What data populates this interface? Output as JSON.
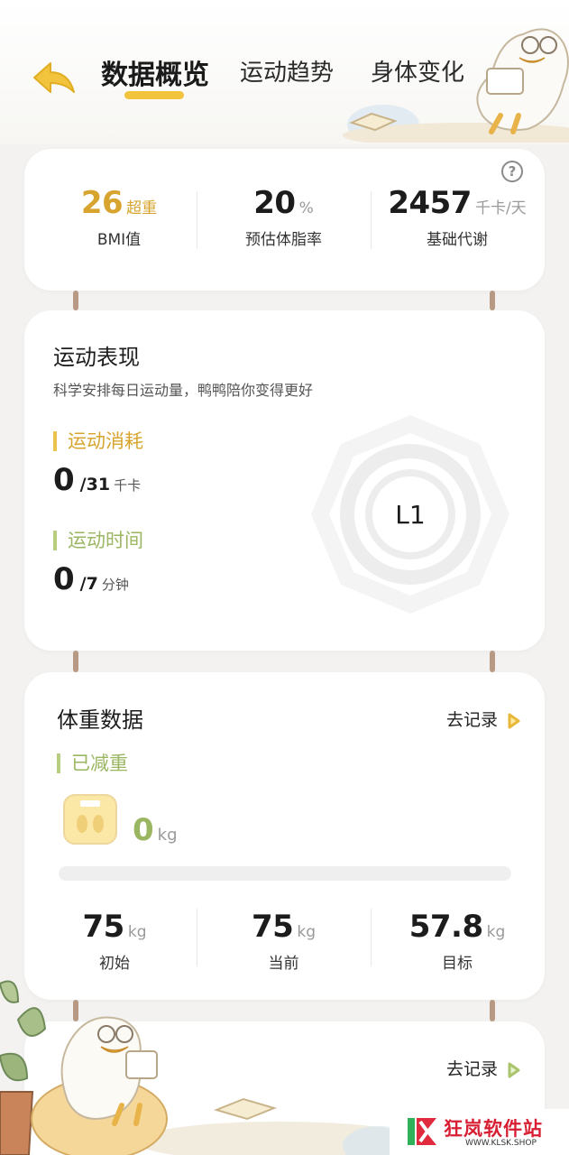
{
  "header": {
    "tabs": [
      {
        "label": "数据概览",
        "active": true
      },
      {
        "label": "运动趋势",
        "active": false
      },
      {
        "label": "身体变化",
        "active": false
      }
    ]
  },
  "summary": {
    "bmi": {
      "value": "26",
      "status": "超重",
      "label": "BMI值"
    },
    "body_fat": {
      "value": "20",
      "unit": "%",
      "label": "预估体脂率"
    },
    "bmr": {
      "value": "2457",
      "unit": "千卡/天",
      "label": "基础代谢"
    },
    "help_glyph": "?"
  },
  "exercise": {
    "title": "运动表现",
    "subtitle": "科学安排每日运动量，鸭鸭陪你变得更好",
    "calories": {
      "label": "运动消耗",
      "value": "0",
      "target": "/31",
      "unit": "千卡"
    },
    "time": {
      "label": "运动时间",
      "value": "0",
      "target": "/7",
      "unit": "分钟"
    },
    "level": "L1"
  },
  "weight": {
    "title": "体重数据",
    "record_label": "去记录",
    "lost_label": "已减重",
    "lost_value": "0",
    "lost_unit": "kg",
    "progress": 0,
    "initial": {
      "value": "75",
      "unit": "kg",
      "label": "初始"
    },
    "current": {
      "value": "75",
      "unit": "kg",
      "label": "当前"
    },
    "target": {
      "value": "57.8",
      "unit": "kg",
      "label": "目标"
    }
  },
  "next_card": {
    "record_label": "去记录"
  },
  "watermark": {
    "name": "狂岚软件站",
    "url": "WWW.KLSK.SHOP"
  },
  "colors": {
    "accent_yellow": "#f2c43d",
    "gold_text": "#d7a52f",
    "green": "#9bb661",
    "background": "#f3f2f0"
  }
}
